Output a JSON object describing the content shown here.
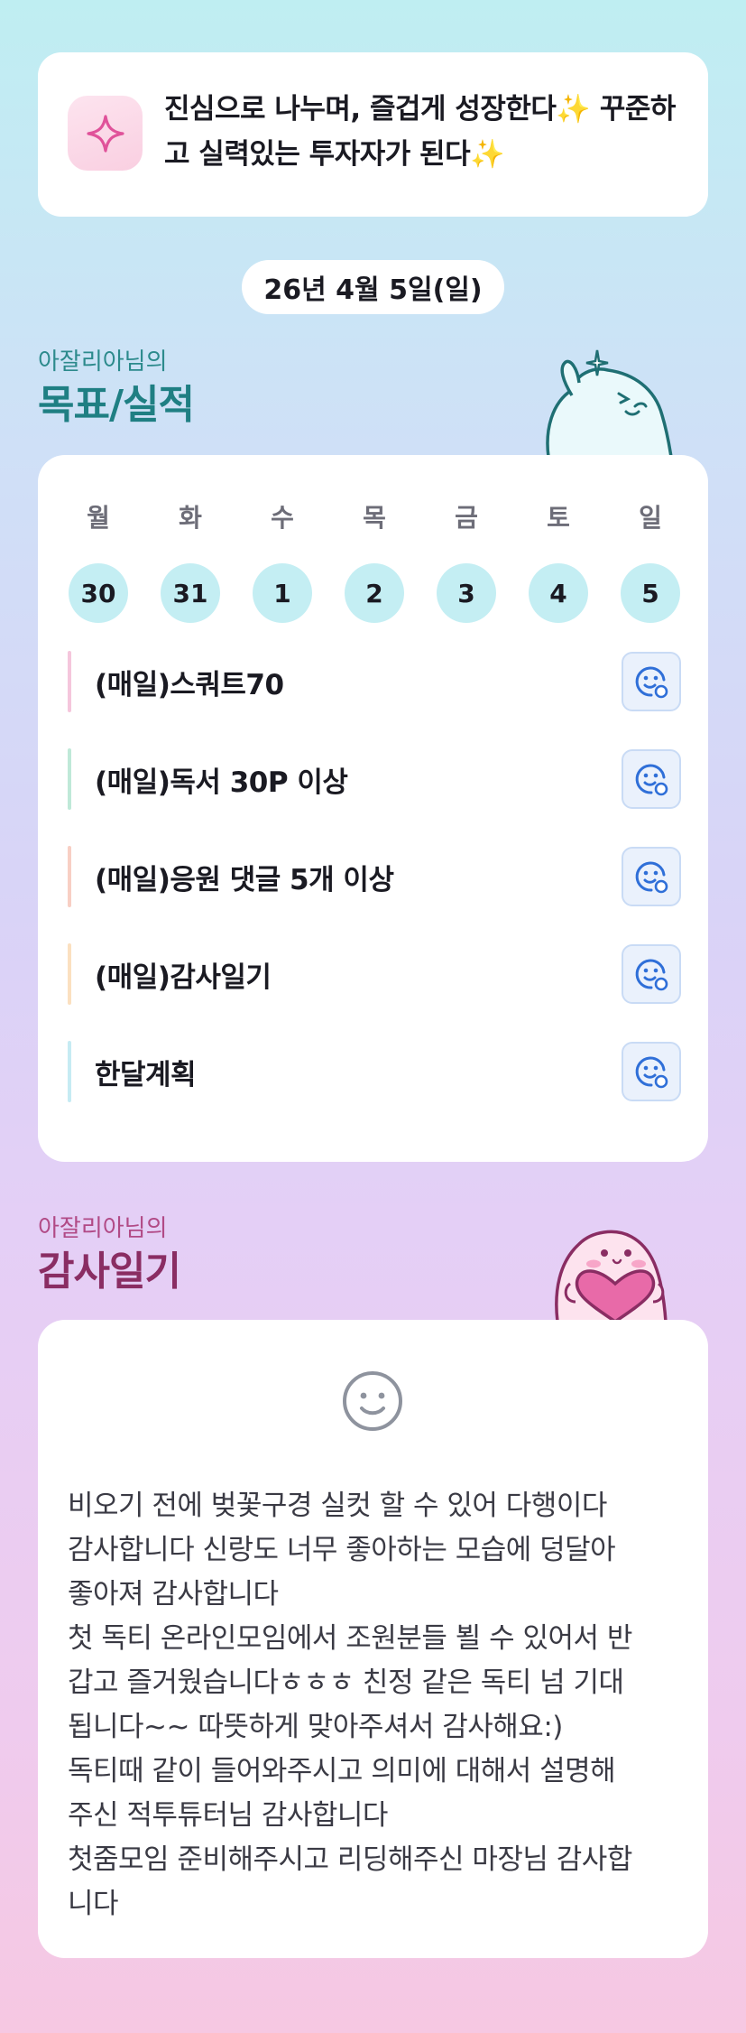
{
  "motto": {
    "text": "진심으로 나누며, 즐겁게 성장한다✨ 꾸준하고 실력있는 투자자가 된다✨",
    "icon": "sparkle-icon"
  },
  "date": "26년 4월 5일(일)",
  "goals_section": {
    "subtitle": "아잘리아님의",
    "title": "목표/실적",
    "week": {
      "days": [
        {
          "label": "월",
          "num": "30"
        },
        {
          "label": "화",
          "num": "31"
        },
        {
          "label": "수",
          "num": "1"
        },
        {
          "label": "목",
          "num": "2"
        },
        {
          "label": "금",
          "num": "3"
        },
        {
          "label": "토",
          "num": "4"
        },
        {
          "label": "일",
          "num": "5"
        }
      ]
    },
    "items": [
      {
        "label": "(매일)스쿼트70",
        "color": "#f5c6dc"
      },
      {
        "label": "(매일)독서 30P 이상",
        "color": "#bfe9d8"
      },
      {
        "label": "(매일)응원 댓글 5개 이상",
        "color": "#f8cfc4"
      },
      {
        "label": "(매일)감사일기",
        "color": "#fbe0c0"
      },
      {
        "label": "한달계획",
        "color": "#c6ebf3"
      }
    ],
    "action_icon": "add-reaction-icon"
  },
  "diary_section": {
    "subtitle": "아잘리아님의",
    "title": "감사일기",
    "mood_icon": "smile-face-icon",
    "text": "비오기 전에 벚꽃구경 실컷 할 수 있어 다행이다\n감사합니다 신랑도 너무 좋아하는 모습에 덩달아\n좋아져 감사합니다\n첫 독티 온라인모임에서 조원분들 뵐 수 있어서 반\n갑고 즐거웠습니다ㅎㅎㅎ 친정 같은 독티 넘 기대\n됩니다~~ 따뜻하게 맞아주셔서 감사해요:)\n독티때 같이 들어와주시고 의미에 대해서 설명해\n주신 적투튜터님 감사합니다\n첫줌모임 준비해주시고 리딩해주신 마장님 감사합\n니다"
  },
  "colors": {
    "teal_title": "#1f7f83",
    "pink_title": "#8a2d63",
    "day_circle": "#c4eef3",
    "button_blue": "#2f6fd8"
  }
}
